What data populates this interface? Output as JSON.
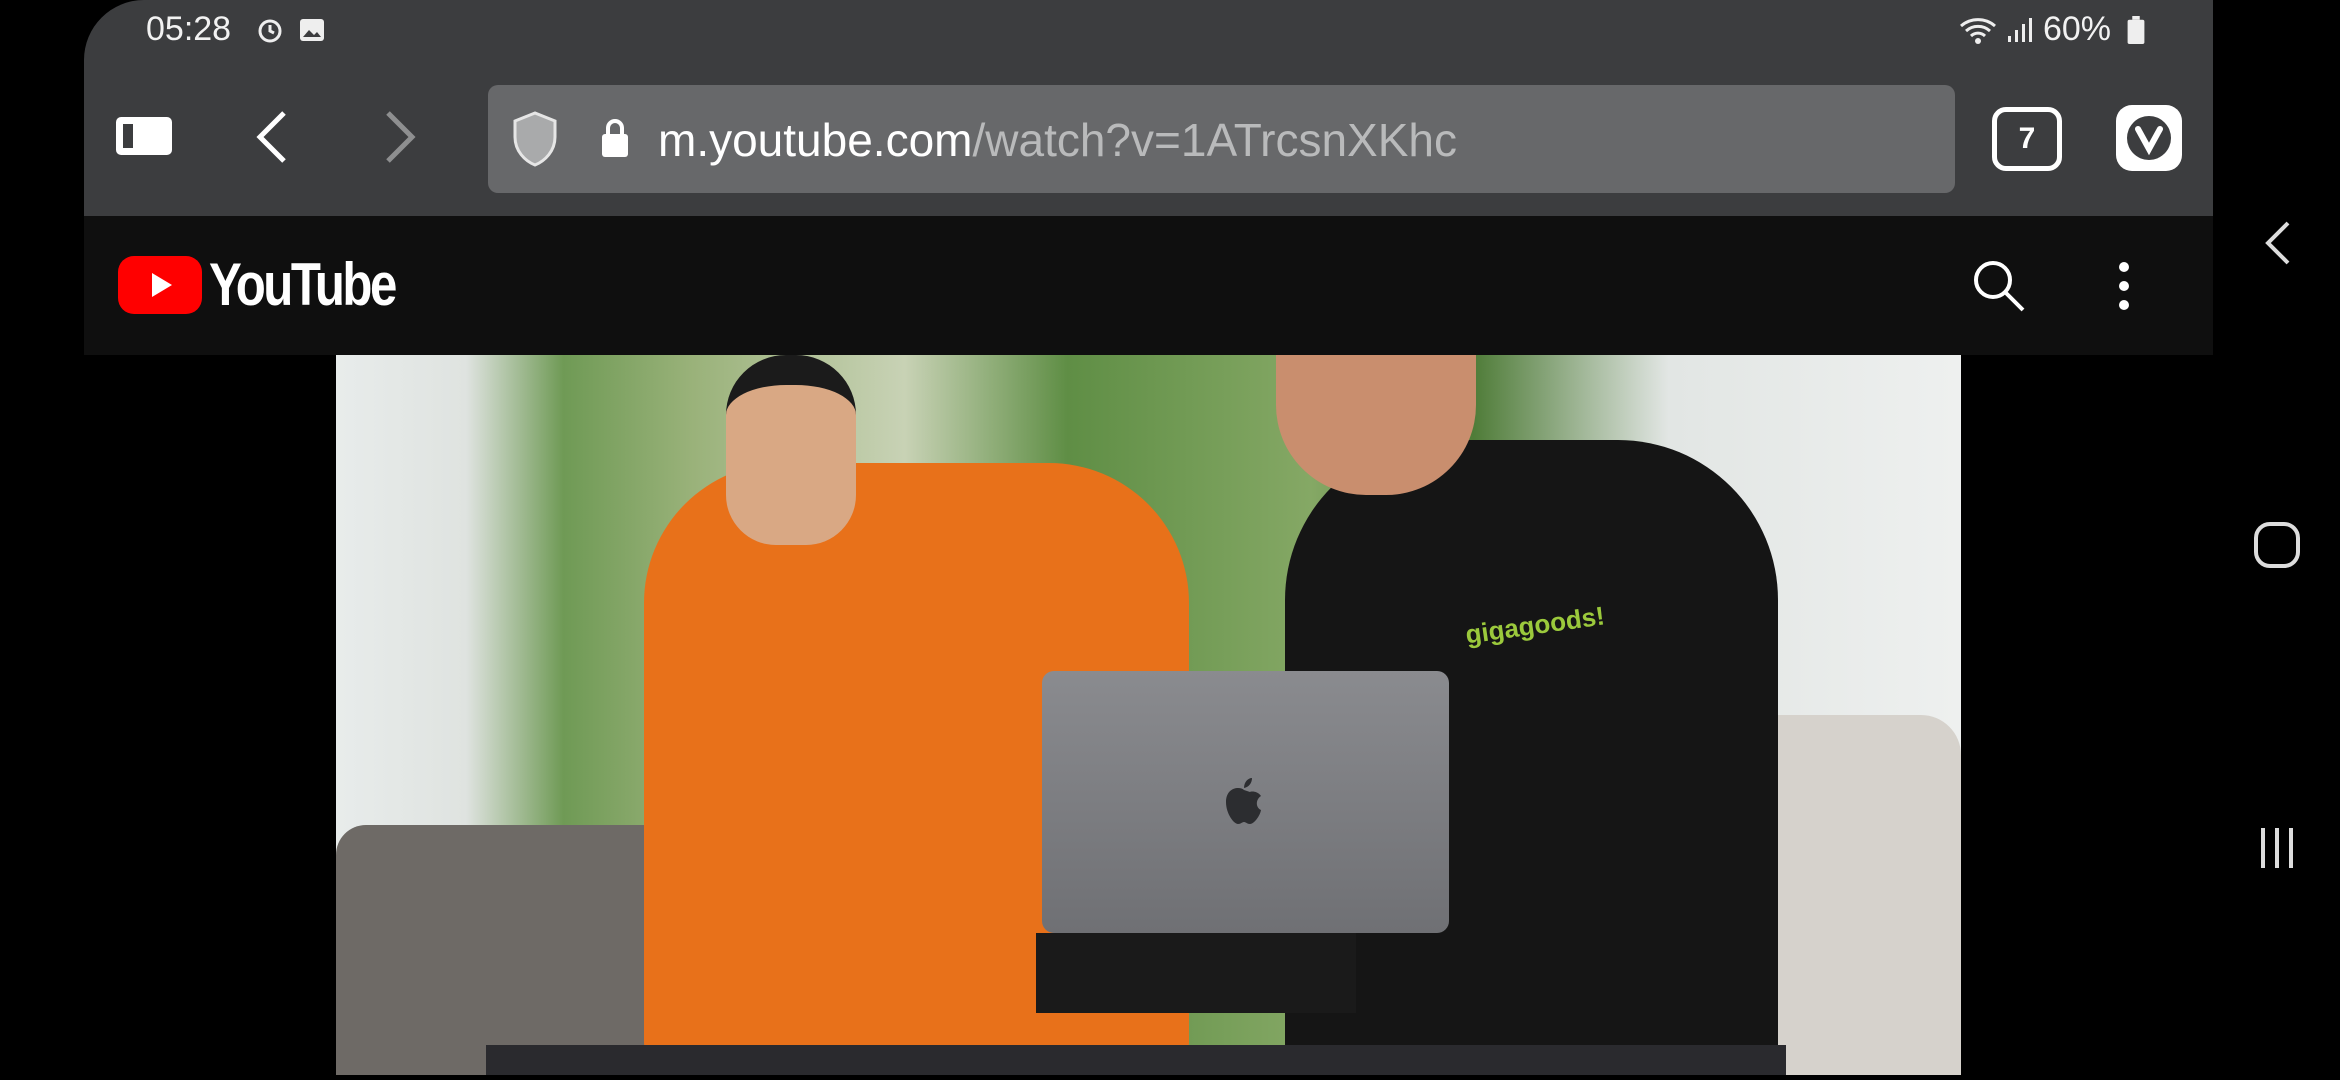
{
  "status_bar": {
    "time": "05:28",
    "battery": "60%",
    "icons": [
      "alarm-icon",
      "image-icon",
      "wifi-icon",
      "signal-icon",
      "battery-icon"
    ]
  },
  "browser": {
    "url_host": "m.youtube.com",
    "url_path": "/watch?v=1ATrcsnXKhc",
    "tab_count": "7",
    "icons": [
      "panel-toggle-icon",
      "back-icon",
      "forward-icon",
      "shield-icon",
      "lock-icon",
      "vivaldi-icon"
    ]
  },
  "youtube": {
    "logo_text": "YouTube",
    "brand_color": "#ff0000",
    "icons": [
      "search-icon",
      "more-vert-icon"
    ]
  },
  "video": {
    "shirt_text": "gigagoods!"
  },
  "nav_bar": {
    "icons": [
      "back-icon",
      "home-icon",
      "recents-icon"
    ]
  }
}
